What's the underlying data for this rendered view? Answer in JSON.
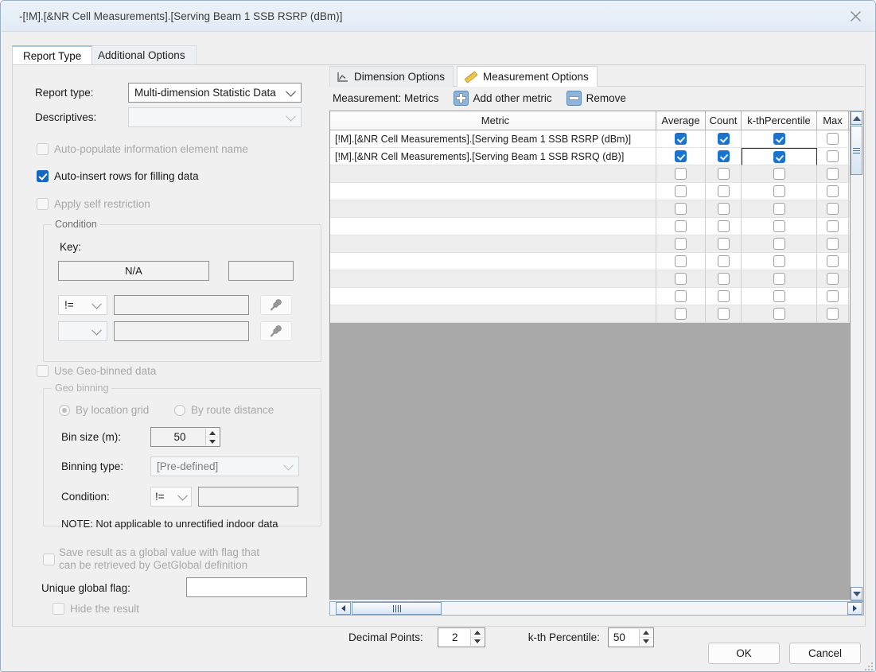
{
  "window": {
    "title": "-[!M].[&NR Cell Measurements].[Serving Beam 1 SSB RSRP (dBm)]",
    "close_icon": "close-icon"
  },
  "outer_tabs": [
    {
      "label": "Report Type",
      "active": true
    },
    {
      "label": "Additional Options",
      "active": false
    }
  ],
  "left_panel": {
    "report_type_label": "Report type:",
    "report_type_value": "Multi-dimension Statistic Data",
    "descriptives_label": "Descriptives:",
    "descriptives_value": "",
    "checkboxes": [
      {
        "label": "Auto-populate information element name",
        "checked": false,
        "enabled": false
      },
      {
        "label": "Auto-insert rows for filling data",
        "checked": true,
        "enabled": true
      },
      {
        "label": "Apply self restriction",
        "checked": false,
        "enabled": false
      }
    ],
    "condition_group": {
      "title": "Condition",
      "key_label": "Key:",
      "key_value": "N/A",
      "key_extra_value": "",
      "row1_operator": "!=",
      "row1_value": "",
      "row2_operator": "",
      "row2_value": "",
      "pin_icon": "pushpin-icon"
    },
    "geo_checkbox": {
      "label": "Use Geo-binned data",
      "checked": false,
      "enabled": false
    },
    "geo_group": {
      "title": "Geo binning",
      "radio_location_grid": "By location grid",
      "radio_route_distance": "By route distance",
      "radio_selected": "By location grid",
      "bin_size_label": "Bin size (m):",
      "bin_size_value": "50",
      "binning_type_label": "Binning type:",
      "binning_type_value": "[Pre-defined]",
      "condition_label": "Condition:",
      "condition_operator": "!=",
      "condition_value": "",
      "note": "NOTE: Not applicable to unrectified indoor data"
    },
    "save_global": {
      "line1": "Save result as a global value with flag that",
      "line2": "can be retrieved by GetGlobal definition",
      "checked": false
    },
    "unique_flag_label": "Unique global flag:",
    "unique_flag_value": "",
    "hide_result": {
      "label": "Hide the result",
      "checked": false
    }
  },
  "right_panel": {
    "inner_tabs": [
      {
        "label": "Dimension Options",
        "icon": "line-chart-icon",
        "active": false
      },
      {
        "label": "Measurement Options",
        "icon": "ruler-icon",
        "active": true
      }
    ],
    "toolbar": {
      "title": "Measurement: Metrics",
      "add_label": "Add other metric",
      "add_icon": "plus-square-icon",
      "remove_label": "Remove",
      "remove_icon": "minus-square-icon"
    },
    "grid": {
      "columns": [
        "Metric",
        "Average",
        "Count",
        "k-thPercentile",
        "Max"
      ],
      "rows": [
        {
          "metric": "[!M].[&NR Cell Measurements].[Serving Beam 1 SSB RSRP (dBm)]",
          "average": true,
          "count": true,
          "percentile": true,
          "max": false,
          "focused": false
        },
        {
          "metric": "[!M].[&NR Cell Measurements].[Serving Beam 1 SSB RSRQ (dB)]",
          "average": true,
          "count": true,
          "percentile": true,
          "max": false,
          "focused": true
        },
        {
          "metric": "",
          "average": false,
          "count": false,
          "percentile": false,
          "max": false,
          "focused": false
        },
        {
          "metric": "",
          "average": false,
          "count": false,
          "percentile": false,
          "max": false,
          "focused": false
        },
        {
          "metric": "",
          "average": false,
          "count": false,
          "percentile": false,
          "max": false,
          "focused": false
        },
        {
          "metric": "",
          "average": false,
          "count": false,
          "percentile": false,
          "max": false,
          "focused": false
        },
        {
          "metric": "",
          "average": false,
          "count": false,
          "percentile": false,
          "max": false,
          "focused": false
        },
        {
          "metric": "",
          "average": false,
          "count": false,
          "percentile": false,
          "max": false,
          "focused": false
        },
        {
          "metric": "",
          "average": false,
          "count": false,
          "percentile": false,
          "max": false,
          "focused": false
        },
        {
          "metric": "",
          "average": false,
          "count": false,
          "percentile": false,
          "max": false,
          "focused": false
        },
        {
          "metric": "",
          "average": false,
          "count": false,
          "percentile": false,
          "max": false,
          "focused": false
        }
      ]
    },
    "bottom": {
      "decimal_points_label": "Decimal Points:",
      "decimal_points_value": "2",
      "percentile_label": "k-th Percentile:",
      "percentile_value": "50"
    }
  },
  "footer": {
    "ok_label": "OK",
    "cancel_label": "Cancel"
  },
  "colors": {
    "accent": "#1766c0",
    "grid_checked": "#1a73cf",
    "window_border": "#9aafc4",
    "dialog_bg": "#f0f0f0",
    "grid_empty_area": "#a9a9a9"
  }
}
